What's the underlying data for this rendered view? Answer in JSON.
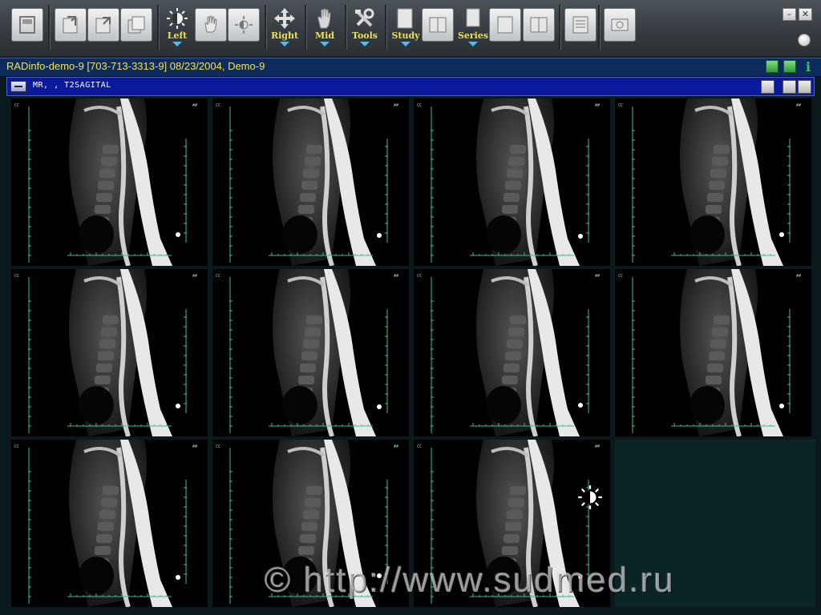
{
  "toolbar": {
    "labels": {
      "left": "Left",
      "right": "Right",
      "mid": "Mid",
      "tools": "Tools",
      "study": "Study",
      "series": "Series"
    }
  },
  "window": {
    "title": "RADinfo-demo-9 [703-713-3313-9] 08/23/2004, Demo-9"
  },
  "series_bar": {
    "title": "MR, , T2SAGITAL"
  },
  "viewer": {
    "image_count": 11,
    "layout": "4x3",
    "selected_image": 1
  },
  "watermark": "© http://www.sudmed.ru",
  "colors": {
    "selection": "#22d36b",
    "label_text": "#e8e05a",
    "title_text": "#f2e25a",
    "series_bar": "#0a1a9a"
  }
}
